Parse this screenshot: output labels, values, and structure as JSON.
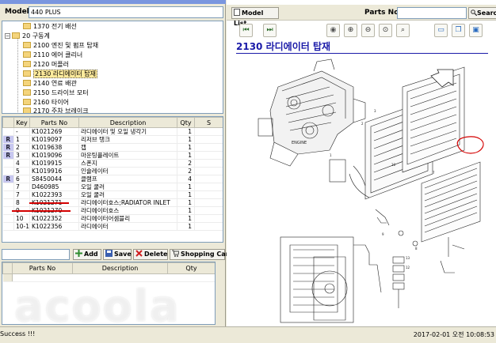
{
  "model": {
    "label": "Model",
    "value": "440 PLUS"
  },
  "tree": {
    "items": [
      {
        "label": "1370 전기 배선",
        "level": 2
      },
      {
        "label": "20 구동계",
        "level": 1,
        "expanded": true
      },
      {
        "label": "2100 엔진 및 펌프 탑재",
        "level": 2
      },
      {
        "label": "2110 에어 클리너",
        "level": 2
      },
      {
        "label": "2120 머플러",
        "level": 2
      },
      {
        "label": "2130 라디에이터 탑재",
        "level": 2,
        "selected": true
      },
      {
        "label": "2140 연료 배관",
        "level": 2
      },
      {
        "label": "2150 드라이브 모터",
        "level": 2
      },
      {
        "label": "2160 타이어",
        "level": 2
      },
      {
        "label": "2170 주차 브레이크",
        "level": 2
      }
    ]
  },
  "parts_grid": {
    "headers": [
      "Key",
      "Parts No",
      "Description",
      "Qty",
      "S"
    ],
    "rows": [
      {
        "mark": "",
        "key": "-",
        "parts_no": "K1021269",
        "desc": "라디에이터 및 오일 냉각기",
        "qty": "1"
      },
      {
        "mark": "R",
        "key": "1",
        "parts_no": "K1019097",
        "desc": "리저브 탱크",
        "qty": "1"
      },
      {
        "mark": "R",
        "key": "2",
        "parts_no": "K1019638",
        "desc": "캡",
        "qty": "1"
      },
      {
        "mark": "R",
        "key": "3",
        "parts_no": "K1019096",
        "desc": "마운팅플레이트",
        "qty": "1"
      },
      {
        "mark": "",
        "key": "4",
        "parts_no": "K1019915",
        "desc": "스폰지",
        "qty": "2"
      },
      {
        "mark": "",
        "key": "5",
        "parts_no": "K1019916",
        "desc": "인슐레이터",
        "qty": "2"
      },
      {
        "mark": "R",
        "key": "6",
        "parts_no": "S8450044",
        "desc": "클램프",
        "qty": "4"
      },
      {
        "mark": "",
        "key": "7",
        "parts_no": "D460985",
        "desc": "오일 쿨러",
        "qty": "1"
      },
      {
        "mark": "",
        "key": "7",
        "parts_no": "K1022393",
        "desc": "오일 쿨러",
        "qty": "1"
      },
      {
        "mark": "",
        "key": "8",
        "parts_no": "K1021271",
        "desc": "라디에이터호스;RADIATOR INLET",
        "qty": "1"
      },
      {
        "mark": "",
        "key": "9",
        "parts_no": "K1021270",
        "desc": "라디에이터호스",
        "qty": "1"
      },
      {
        "mark": "",
        "key": "10",
        "parts_no": "K1022352",
        "desc": "라디에이터어셈블리",
        "qty": "1"
      },
      {
        "mark": "",
        "key": "10-1",
        "parts_no": "K1022356",
        "desc": "라디에이터",
        "qty": "1"
      }
    ]
  },
  "actions": {
    "add": "Add",
    "save": "Save",
    "delete": "Delete",
    "cart": "Shopping Cart"
  },
  "cart": {
    "headers": [
      "Parts No",
      "Description",
      "Qty"
    ]
  },
  "watermark": "acoola",
  "right": {
    "model_list_btn": "Model List",
    "parts_no_label": "Parts No",
    "search_btn": "Search",
    "section_title": "2130 라디에이터 탑재"
  },
  "status": {
    "left": "Success !!!",
    "right": "2017-02-01 오전 10:08:53"
  },
  "colors": {
    "title_blue": "#1a1aa8",
    "highlight_red": "#d40000",
    "selected_tree": "#ffeb9c",
    "mark_bg": "#c7c7f0"
  }
}
